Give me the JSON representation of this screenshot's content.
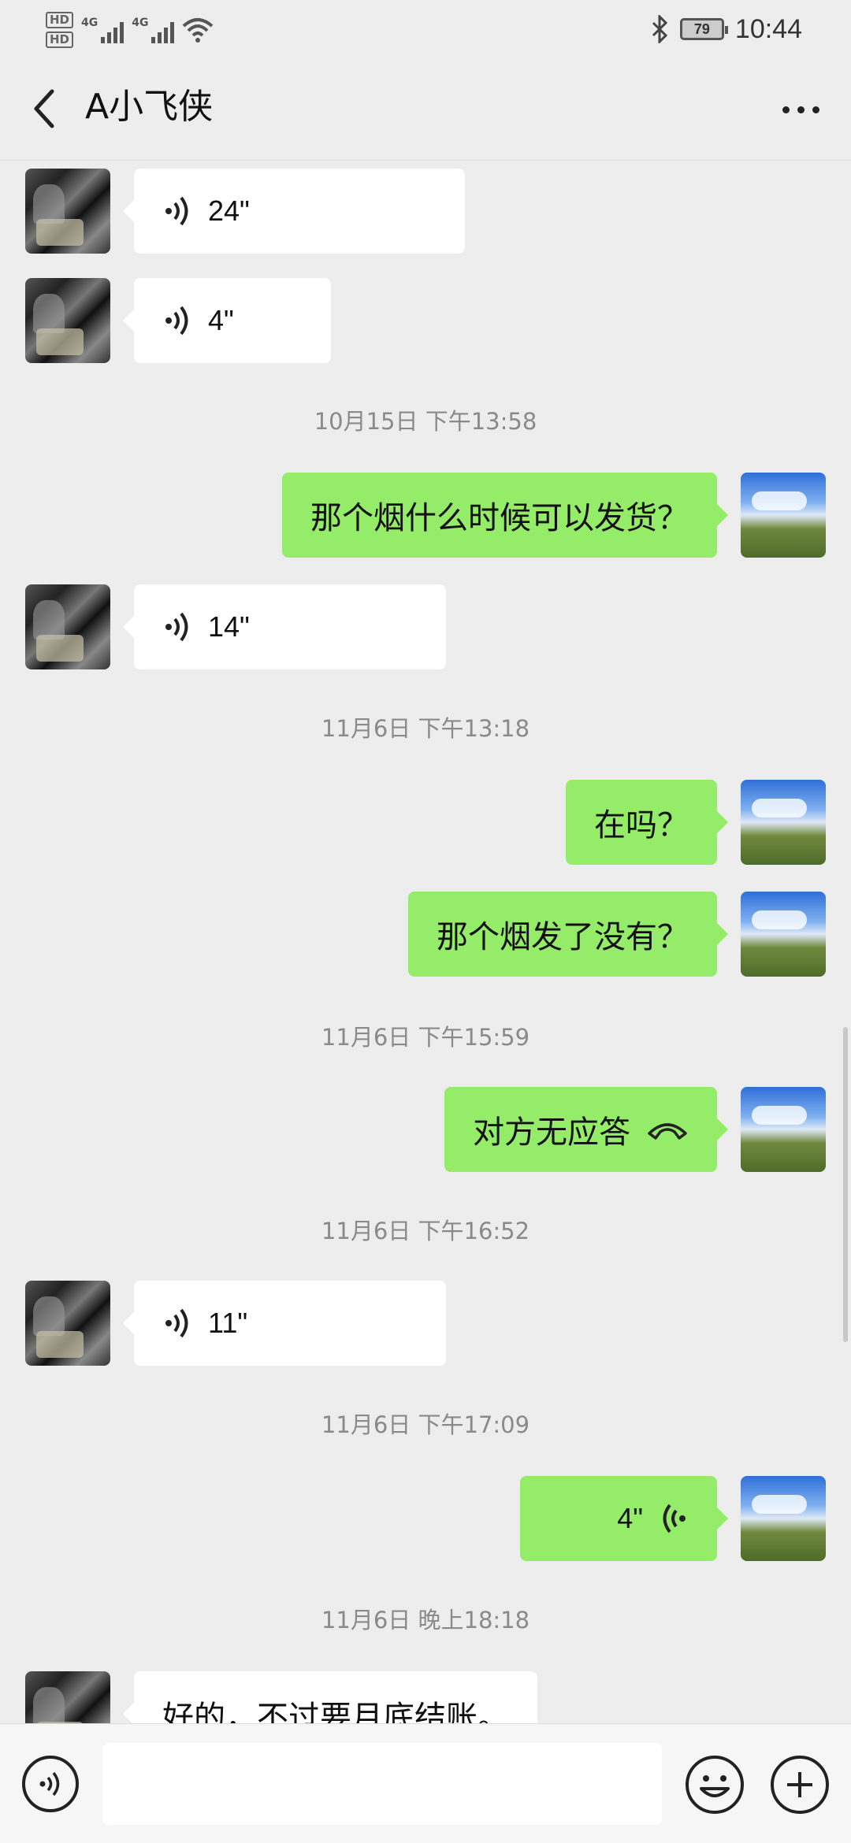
{
  "status_bar": {
    "sim1_label": "HD",
    "sim2_label": "HD",
    "network1": "4G",
    "network2": "4G",
    "battery": "79",
    "time": "10:44"
  },
  "header": {
    "title": "A小飞侠",
    "back_icon": "chevron-left-icon",
    "more_icon": "more-dots-icon"
  },
  "messages": [
    {
      "side": "in",
      "type": "voice",
      "duration": "24\""
    },
    {
      "side": "in",
      "type": "voice",
      "duration": "4\""
    },
    {
      "type": "time",
      "text": "10月15日 下午13:58"
    },
    {
      "side": "out",
      "type": "text",
      "text": "那个烟什么时候可以发货？"
    },
    {
      "side": "in",
      "type": "voice",
      "duration": "14\""
    },
    {
      "type": "time",
      "text": "11月6日 下午13:18"
    },
    {
      "side": "out",
      "type": "text",
      "text": "在吗？"
    },
    {
      "side": "out",
      "type": "text",
      "text": "那个烟发了没有？"
    },
    {
      "type": "time",
      "text": "11月6日 下午15:59"
    },
    {
      "side": "out",
      "type": "call",
      "text": "对方无应答"
    },
    {
      "type": "time",
      "text": "11月6日 下午16:52"
    },
    {
      "side": "in",
      "type": "voice",
      "duration": "11\""
    },
    {
      "type": "time",
      "text": "11月6日 下午17:09"
    },
    {
      "side": "out",
      "type": "voice",
      "duration": "4\""
    },
    {
      "type": "time",
      "text": "11月6日 晚上18:18"
    },
    {
      "side": "in",
      "type": "text",
      "text": "好的，不过要月底结账。"
    }
  ],
  "input_bar": {
    "voice_icon": "voice-input-icon",
    "emoji_icon": "emoji-icon",
    "plus_icon": "plus-icon"
  },
  "colors": {
    "background": "#ededed",
    "outgoing_bubble": "#95ec69",
    "incoming_bubble": "#ffffff"
  }
}
